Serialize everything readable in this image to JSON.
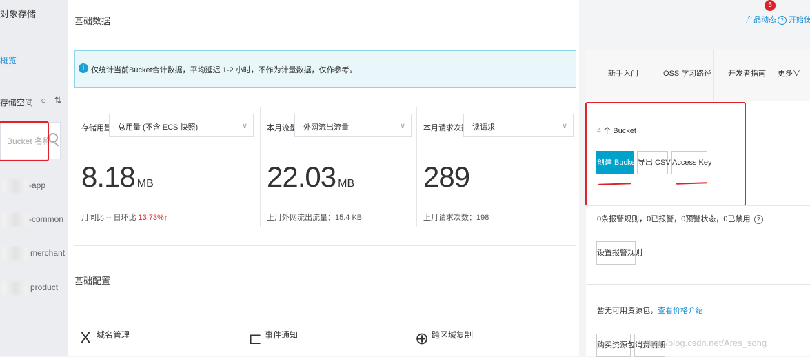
{
  "sidebar": {
    "title": "对象存储",
    "overview": "概览",
    "storage_label": "存储空间",
    "tools": "+ ○ ⇅ ☑",
    "search_placeholder": "Bucket 名称",
    "buckets": [
      "-app",
      "-common",
      "merchant",
      "product"
    ]
  },
  "header": {
    "title": "基础数据",
    "product_news": "产品动态",
    "badge_count": "5",
    "help_link": "开始使用",
    "help_icon": "?"
  },
  "info": {
    "icon": "i",
    "text": "仅统计当前Bucket合计数据，平均延迟 1-2 小时，不作为计量数据，仅作参考。"
  },
  "metrics": [
    {
      "label": "存储用量",
      "select": "总用量 (不含 ECS 快照)",
      "value": "8.18",
      "unit": "MB",
      "sub_prefix": "月同比 -- 日环比",
      "sub_highlight": "13.73%↑"
    },
    {
      "label": "本月流量",
      "select": "外网流出流量",
      "value": "22.03",
      "unit": "MB",
      "sub_prefix": "上月外网流出流量：15.4 KB",
      "sub_highlight": ""
    },
    {
      "label": "本月请求次数",
      "select": "读请求",
      "value": "289",
      "unit": "",
      "sub_prefix": "上月请求次数：198",
      "sub_highlight": ""
    }
  ],
  "config": {
    "title": "基础配置",
    "items": [
      {
        "label": "域名管理",
        "icon": "X"
      },
      {
        "label": "事件通知",
        "icon": "⊏"
      },
      {
        "label": "跨区域复制",
        "icon": "⊕"
      }
    ]
  },
  "right": {
    "tabs": [
      "新手入门",
      "OSS 学习路径",
      "开发者指南",
      "更多∨"
    ],
    "bucket_count_num": "4",
    "bucket_count_suffix": "个 Bucket",
    "buttons": {
      "create": "创建 Bucket",
      "export": "导出 CSV",
      "access_key": "Access Key"
    },
    "alarm_text": "0条报警规则，0已报警，0预警状态，0已禁用",
    "alarm_help": "?",
    "alarm_button": "设置报警规则",
    "resource_text": "暂无可用资源包，",
    "resource_link": "查看价格介绍",
    "resource_buttons": [
      "购买资源包",
      "消费明细"
    ]
  },
  "watermark": "https://blog.csdn.net/Ares_song",
  "colors": {
    "accent": "#00a2ca",
    "link": "#1a8fd6",
    "annotation": "#e0202a",
    "info_bg": "#e9f7fb"
  }
}
